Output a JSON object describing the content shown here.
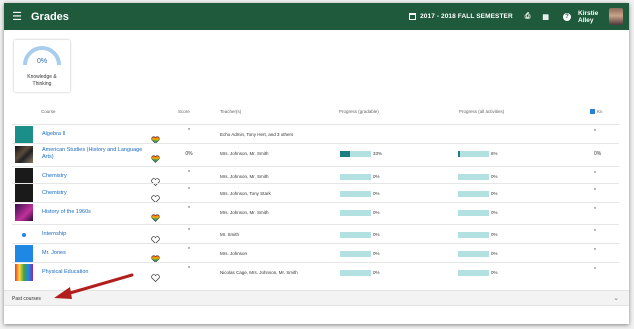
{
  "topbar": {
    "title": "Grades",
    "semester": "2017 - 2018 FALL SEMESTER",
    "user_first": "Kirstie",
    "user_last": "Alley",
    "icons": [
      "menu-icon",
      "calendar-icon",
      "print-icon",
      "columns-icon",
      "help-icon"
    ]
  },
  "summary": {
    "percent": "0%",
    "label_line1": "Knowledge &",
    "label_line2": "Thinking",
    "arc_color": "#a9cdee"
  },
  "table": {
    "headers": {
      "course": "Course",
      "score": "Score",
      "teachers": "Teacher(s)",
      "progress_gradable": "Progress (gradable)",
      "progress_all": "Progress (all activities)",
      "kn": "Kn"
    },
    "rows": [
      {
        "course": "Algebra II",
        "line2": "",
        "heart": "rainbow",
        "score": "*",
        "teacher": "Echo Admin, Tony Hert, and 3 others",
        "show_bars": false,
        "p1_text": "",
        "p1": 0,
        "p2_text": "",
        "p2": 0,
        "kn": "*",
        "thumb": "teal-doc"
      },
      {
        "course": "American Studies (History and Language",
        "line2": "Arts)",
        "heart": "rainbow",
        "score": "0%",
        "teacher": "Mrs. Johnson, Mr. Smith",
        "show_bars": true,
        "p1_text": "33%",
        "p1": 0.33,
        "p2_text": "6%",
        "p2": 0.06,
        "kn": "0%",
        "thumb": "dark-photo"
      },
      {
        "course": "Chemistry",
        "line2": "",
        "heart": "outline",
        "score": "*",
        "teacher": "Mrs. Johnson, Mr. Smith",
        "show_bars": true,
        "p1_text": "0%",
        "p1": 0,
        "p2_text": "0%",
        "p2": 0,
        "kn": "*",
        "thumb": "black"
      },
      {
        "course": "Chemistry",
        "line2": "",
        "heart": "outline",
        "score": "*",
        "teacher": "Mrs. Johnson, Tony Stark",
        "show_bars": true,
        "p1_text": "0%",
        "p1": 0,
        "p2_text": "0%",
        "p2": 0,
        "kn": "*",
        "thumb": "black"
      },
      {
        "course": "History of the 1960s",
        "line2": "",
        "heart": "rainbow",
        "score": "*",
        "teacher": "Mrs. Johnson, Mr. Smith",
        "show_bars": true,
        "p1_text": "0%",
        "p1": 0,
        "p2_text": "0%",
        "p2": 0,
        "kn": "*",
        "thumb": "purple"
      },
      {
        "course": "Internship",
        "line2": "",
        "heart": "outline",
        "score": "*",
        "teacher": "Mr. Smith",
        "show_bars": true,
        "p1_text": "0%",
        "p1": 0,
        "p2_text": "0%",
        "p2": 0,
        "kn": "*",
        "thumb": "blue-dot"
      },
      {
        "course": "Mr. Jones",
        "line2": "",
        "heart": "rainbow",
        "score": "*",
        "teacher": "Mrs. Johnson",
        "show_bars": true,
        "p1_text": "0%",
        "p1": 0,
        "p2_text": "0%",
        "p2": 0,
        "kn": "*",
        "thumb": "blue-tile"
      },
      {
        "course": "Physical Education",
        "line2": "",
        "heart": "outline",
        "score": "*",
        "teacher": "Nicolas Cage, Mrs. Johnson, Mr. Smith",
        "show_bars": true,
        "p1_text": "0%",
        "p1": 0,
        "p2_text": "0%",
        "p2": 0,
        "kn": "*",
        "thumb": "colorful"
      }
    ]
  },
  "past_courses": {
    "label": "Past courses"
  },
  "colors": {
    "topbar": "#1e5a3b",
    "link": "#1a6cc0",
    "bar_bg": "#b3e1e1",
    "bar_fill": "#1e7f80",
    "arrow": "#b21e1e"
  }
}
